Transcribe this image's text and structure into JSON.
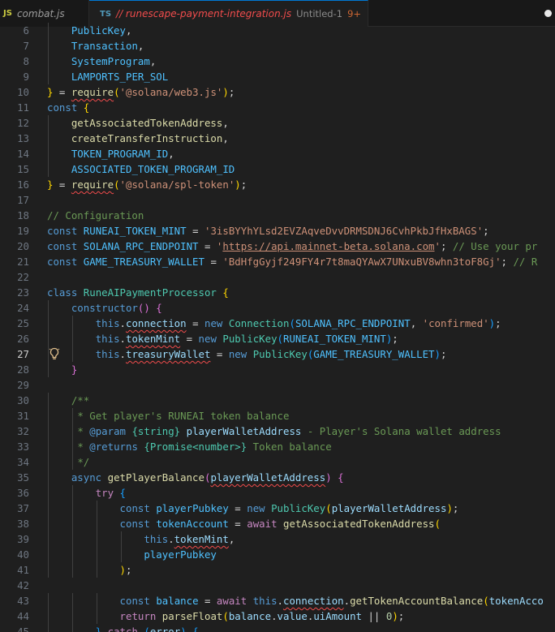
{
  "tabs": [
    {
      "icon": "JS",
      "name": "combat.js"
    },
    {
      "icon": "TS",
      "name": "// runescape-payment-integration.js",
      "subtitle": "Untitled-1",
      "problems": "9+"
    }
  ],
  "code_lines": [
    {
      "num": "6",
      "segments": [
        [
          "",
          "    "
        ],
        [
          "cn",
          "PublicKey"
        ],
        [
          "p",
          ","
        ]
      ]
    },
    {
      "num": "7",
      "segments": [
        [
          "",
          "    "
        ],
        [
          "cn",
          "Transaction"
        ],
        [
          "p",
          ","
        ]
      ]
    },
    {
      "num": "8",
      "segments": [
        [
          "",
          "    "
        ],
        [
          "cn",
          "SystemProgram"
        ],
        [
          "p",
          ","
        ]
      ]
    },
    {
      "num": "9",
      "segments": [
        [
          "",
          "    "
        ],
        [
          "cn",
          "LAMPORTS_PER_SOL"
        ]
      ]
    },
    {
      "num": "10",
      "segments": [
        [
          "b1",
          "}"
        ],
        [
          "p",
          " = "
        ],
        [
          "f sq",
          "require"
        ],
        [
          "b1",
          "("
        ],
        [
          "s",
          "'@solana/web3.js'"
        ],
        [
          "b1",
          ")"
        ],
        [
          "p",
          ";"
        ]
      ]
    },
    {
      "num": "11",
      "segments": [
        [
          "k",
          "const"
        ],
        [
          "p",
          " "
        ],
        [
          "b1",
          "{"
        ]
      ]
    },
    {
      "num": "12",
      "segments": [
        [
          "",
          "    "
        ],
        [
          "f",
          "getAssociatedTokenAddress"
        ],
        [
          "p",
          ","
        ]
      ]
    },
    {
      "num": "13",
      "segments": [
        [
          "",
          "    "
        ],
        [
          "f",
          "createTransferInstruction"
        ],
        [
          "p",
          ","
        ]
      ]
    },
    {
      "num": "14",
      "segments": [
        [
          "",
          "    "
        ],
        [
          "cn",
          "TOKEN_PROGRAM_ID"
        ],
        [
          "p",
          ","
        ]
      ]
    },
    {
      "num": "15",
      "segments": [
        [
          "",
          "    "
        ],
        [
          "cn",
          "ASSOCIATED_TOKEN_PROGRAM_ID"
        ]
      ]
    },
    {
      "num": "16",
      "segments": [
        [
          "b1",
          "}"
        ],
        [
          "p",
          " = "
        ],
        [
          "f sq",
          "require"
        ],
        [
          "b1",
          "("
        ],
        [
          "s",
          "'@solana/spl-token'"
        ],
        [
          "b1",
          ")"
        ],
        [
          "p",
          ";"
        ]
      ]
    },
    {
      "num": "17",
      "segments": []
    },
    {
      "num": "18",
      "segments": [
        [
          "cm",
          "// Configuration"
        ]
      ]
    },
    {
      "num": "19",
      "segments": [
        [
          "k",
          "const"
        ],
        [
          "p",
          " "
        ],
        [
          "cn",
          "RUNEAI_TOKEN_MINT"
        ],
        [
          "p",
          " = "
        ],
        [
          "s",
          "'3isBYYhYLsd2EVZAqveDvvDRMSDNJ6CvhPkbJfHxBAGS'"
        ],
        [
          "p",
          ";"
        ]
      ]
    },
    {
      "num": "20",
      "segments": [
        [
          "k",
          "const"
        ],
        [
          "p",
          " "
        ],
        [
          "cn",
          "SOLANA_RPC_ENDPOINT"
        ],
        [
          "p",
          " = "
        ],
        [
          "s",
          "'"
        ],
        [
          "s url",
          "https://api.mainnet-beta.solana.com"
        ],
        [
          "s",
          "'"
        ],
        [
          "p",
          "; "
        ],
        [
          "cm",
          "// Use your pr"
        ]
      ]
    },
    {
      "num": "21",
      "segments": [
        [
          "k",
          "const"
        ],
        [
          "p",
          " "
        ],
        [
          "cn",
          "GAME_TREASURY_WALLET"
        ],
        [
          "p",
          " = "
        ],
        [
          "s",
          "'BdHfgGyjf249FY4r7t8maQYAwX7UNxuBV8whn3toF8Gj'"
        ],
        [
          "p",
          "; "
        ],
        [
          "cm",
          "// R"
        ]
      ]
    },
    {
      "num": "22",
      "segments": []
    },
    {
      "num": "23",
      "segments": [
        [
          "k",
          "class"
        ],
        [
          "p",
          " "
        ],
        [
          "t",
          "RuneAIPaymentProcessor"
        ],
        [
          "p",
          " "
        ],
        [
          "b1",
          "{"
        ]
      ]
    },
    {
      "num": "24",
      "segments": [
        [
          "",
          "    "
        ],
        [
          "k",
          "constructor"
        ],
        [
          "b2",
          "()"
        ],
        [
          "p",
          " "
        ],
        [
          "b2",
          "{"
        ]
      ]
    },
    {
      "num": "25",
      "segments": [
        [
          "",
          "        "
        ],
        [
          "k",
          "this"
        ],
        [
          "p",
          "."
        ],
        [
          "v sq",
          "connection"
        ],
        [
          "p",
          " = "
        ],
        [
          "k",
          "new"
        ],
        [
          "p",
          " "
        ],
        [
          "t",
          "Connection"
        ],
        [
          "b3",
          "("
        ],
        [
          "cn",
          "SOLANA_RPC_ENDPOINT"
        ],
        [
          "p",
          ", "
        ],
        [
          "s",
          "'confirmed'"
        ],
        [
          "b3",
          ")"
        ],
        [
          "p",
          ";"
        ]
      ]
    },
    {
      "num": "26",
      "segments": [
        [
          "",
          "        "
        ],
        [
          "k",
          "this"
        ],
        [
          "p",
          "."
        ],
        [
          "v sq",
          "tokenMint"
        ],
        [
          "p",
          " = "
        ],
        [
          "k",
          "new"
        ],
        [
          "p",
          " "
        ],
        [
          "t",
          "PublicKey"
        ],
        [
          "b3",
          "("
        ],
        [
          "cn",
          "RUNEAI_TOKEN_MINT"
        ],
        [
          "b3",
          ")"
        ],
        [
          "p",
          ";"
        ]
      ]
    },
    {
      "num": "27",
      "active": true,
      "segments": [
        [
          "",
          "        "
        ],
        [
          "k",
          "this"
        ],
        [
          "p",
          "."
        ],
        [
          "v sq",
          "treasuryWallet"
        ],
        [
          "p",
          " = "
        ],
        [
          "k",
          "new"
        ],
        [
          "p",
          " "
        ],
        [
          "t",
          "PublicKey"
        ],
        [
          "b3",
          "("
        ],
        [
          "cn",
          "GAME_TREASURY_WALLET"
        ],
        [
          "b3",
          ")"
        ],
        [
          "p",
          ";"
        ]
      ]
    },
    {
      "num": "28",
      "segments": [
        [
          "",
          "    "
        ],
        [
          "b2",
          "}"
        ]
      ]
    },
    {
      "num": "29",
      "segments": []
    },
    {
      "num": "30",
      "segments": [
        [
          "",
          "    "
        ],
        [
          "cm",
          "/**"
        ]
      ]
    },
    {
      "num": "31",
      "segments": [
        [
          "",
          "     "
        ],
        [
          "cm",
          "* Get player's RUNEAI token balance"
        ]
      ]
    },
    {
      "num": "32",
      "segments": [
        [
          "",
          "     "
        ],
        [
          "cm",
          "* "
        ],
        [
          "k",
          "@param"
        ],
        [
          "cm",
          " "
        ],
        [
          "t",
          "{string}"
        ],
        [
          "cm",
          " "
        ],
        [
          "v",
          "playerWalletAddress"
        ],
        [
          "cm",
          " - Player's Solana wallet address"
        ]
      ]
    },
    {
      "num": "33",
      "segments": [
        [
          "",
          "     "
        ],
        [
          "cm",
          "* "
        ],
        [
          "k",
          "@returns"
        ],
        [
          "cm",
          " "
        ],
        [
          "t",
          "{Promise<number>}"
        ],
        [
          "cm",
          " Token balance"
        ]
      ]
    },
    {
      "num": "34",
      "segments": [
        [
          "",
          "     "
        ],
        [
          "cm",
          "*/"
        ]
      ]
    },
    {
      "num": "35",
      "segments": [
        [
          "",
          "    "
        ],
        [
          "k",
          "async"
        ],
        [
          "p",
          " "
        ],
        [
          "f",
          "getPlayerBalance"
        ],
        [
          "b2",
          "("
        ],
        [
          "v sq",
          "playerWalletAddress"
        ],
        [
          "b2",
          ")"
        ],
        [
          "p",
          " "
        ],
        [
          "b2",
          "{"
        ]
      ]
    },
    {
      "num": "36",
      "segments": [
        [
          "",
          "        "
        ],
        [
          "c",
          "try"
        ],
        [
          "p",
          " "
        ],
        [
          "b3",
          "{"
        ]
      ]
    },
    {
      "num": "37",
      "segments": [
        [
          "",
          "            "
        ],
        [
          "k",
          "const"
        ],
        [
          "p",
          " "
        ],
        [
          "cn",
          "playerPubkey"
        ],
        [
          "p",
          " = "
        ],
        [
          "k",
          "new"
        ],
        [
          "p",
          " "
        ],
        [
          "t",
          "PublicKey"
        ],
        [
          "b1",
          "("
        ],
        [
          "v",
          "playerWalletAddress"
        ],
        [
          "b1",
          ")"
        ],
        [
          "p",
          ";"
        ]
      ]
    },
    {
      "num": "38",
      "segments": [
        [
          "",
          "            "
        ],
        [
          "k",
          "const"
        ],
        [
          "p",
          " "
        ],
        [
          "cn",
          "tokenAccount"
        ],
        [
          "p",
          " = "
        ],
        [
          "c",
          "await"
        ],
        [
          "p",
          " "
        ],
        [
          "f",
          "getAssociatedTokenAddress"
        ],
        [
          "b1",
          "("
        ]
      ]
    },
    {
      "num": "39",
      "segments": [
        [
          "",
          "                "
        ],
        [
          "k",
          "this"
        ],
        [
          "p",
          "."
        ],
        [
          "v sq",
          "tokenMint"
        ],
        [
          "p",
          ","
        ]
      ]
    },
    {
      "num": "40",
      "segments": [
        [
          "",
          "                "
        ],
        [
          "cn",
          "playerPubkey"
        ]
      ]
    },
    {
      "num": "41",
      "segments": [
        [
          "",
          "            "
        ],
        [
          "b1",
          ")"
        ],
        [
          "p",
          ";"
        ]
      ]
    },
    {
      "num": "42",
      "segments": []
    },
    {
      "num": "43",
      "segments": [
        [
          "",
          "            "
        ],
        [
          "k",
          "const"
        ],
        [
          "p",
          " "
        ],
        [
          "cn",
          "balance"
        ],
        [
          "p",
          " = "
        ],
        [
          "c",
          "await"
        ],
        [
          "p",
          " "
        ],
        [
          "k",
          "this"
        ],
        [
          "p",
          "."
        ],
        [
          "v sq",
          "connection"
        ],
        [
          "p",
          "."
        ],
        [
          "f",
          "getTokenAccountBalance"
        ],
        [
          "b1",
          "("
        ],
        [
          "v",
          "tokenAcco"
        ]
      ]
    },
    {
      "num": "44",
      "segments": [
        [
          "",
          "            "
        ],
        [
          "c",
          "return"
        ],
        [
          "p",
          " "
        ],
        [
          "f",
          "parseFloat"
        ],
        [
          "b1",
          "("
        ],
        [
          "v",
          "balance"
        ],
        [
          "p",
          "."
        ],
        [
          "v",
          "value"
        ],
        [
          "p",
          "."
        ],
        [
          "v",
          "uiAmount"
        ],
        [
          "p",
          " || "
        ],
        [
          "n",
          "0"
        ],
        [
          "b1",
          ")"
        ],
        [
          "p",
          ";"
        ]
      ]
    },
    {
      "num": "45",
      "segments": [
        [
          "",
          "        "
        ],
        [
          "b3",
          "}"
        ],
        [
          "p",
          " "
        ],
        [
          "c",
          "catch"
        ],
        [
          "p",
          " "
        ],
        [
          "b3",
          "("
        ],
        [
          "v",
          "error"
        ],
        [
          "b3",
          ")"
        ],
        [
          "p",
          " "
        ],
        [
          "b3",
          "{"
        ]
      ]
    }
  ]
}
